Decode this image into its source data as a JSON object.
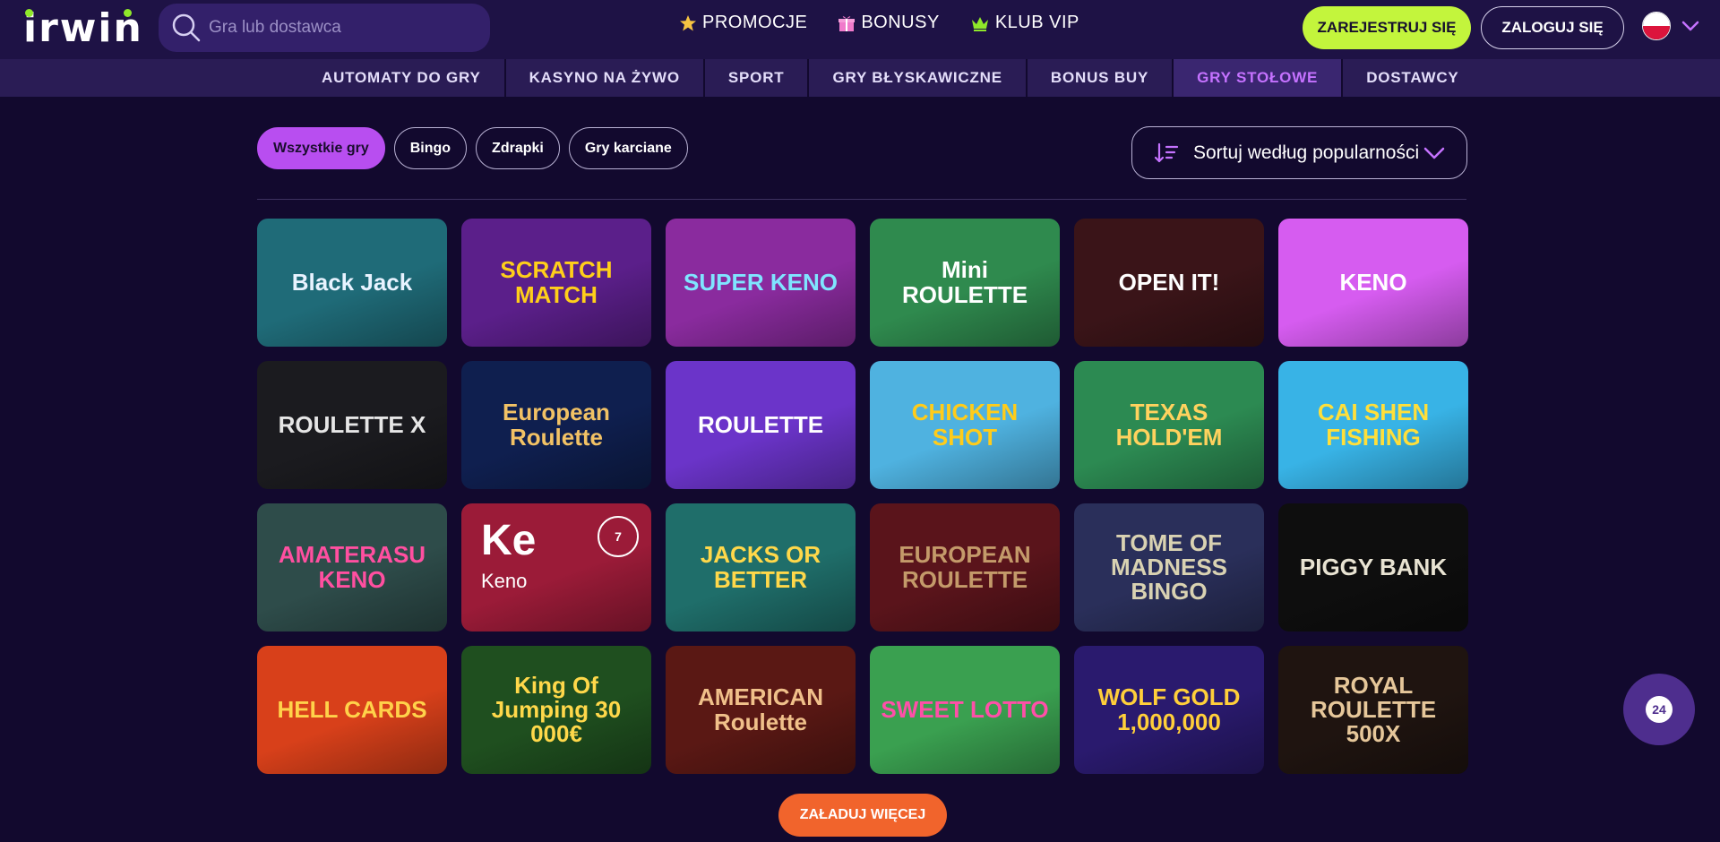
{
  "header": {
    "logo": "irwin",
    "search_placeholder": "Gra lub dostawca",
    "nav": [
      {
        "label": "PROMOCJE",
        "icon": "star-icon"
      },
      {
        "label": "BONUSY",
        "icon": "gift-icon"
      },
      {
        "label": "KLUB VIP",
        "icon": "crown-icon"
      }
    ],
    "register_label": "ZAREJESTRUJ SIĘ",
    "login_label": "ZALOGUJ SIĘ",
    "language_flag": "flag-poland-icon"
  },
  "categories": [
    {
      "label": "AUTOMATY DO GRY",
      "active": false
    },
    {
      "label": "KASYNO NA ŻYWO",
      "active": false
    },
    {
      "label": "SPORT",
      "active": false
    },
    {
      "label": "GRY BŁYSKAWICZNE",
      "active": false
    },
    {
      "label": "BONUS BUY",
      "active": false
    },
    {
      "label": "GRY STOŁOWE",
      "active": true
    },
    {
      "label": "DOSTAWCY",
      "active": false
    }
  ],
  "filters": [
    {
      "label": "Wszystkie gry",
      "active": true
    },
    {
      "label": "Bingo",
      "active": false
    },
    {
      "label": "Zdrapki",
      "active": false
    },
    {
      "label": "Gry karciane",
      "active": false
    }
  ],
  "sort": {
    "label": "Sortuj według popularności"
  },
  "games": [
    {
      "title": "Black Jack",
      "bg": "#1f6b78",
      "color": "#e8f3ff"
    },
    {
      "title": "SCRATCH MATCH",
      "bg": "#5b1f8a",
      "color": "#ffcf1a"
    },
    {
      "title": "SUPER KENO",
      "bg": "#8a2b9e",
      "color": "#7fe5ff"
    },
    {
      "title": "Mini ROULETTE",
      "bg": "#2f8a4e",
      "color": "#ffffff"
    },
    {
      "title": "OPEN IT!",
      "bg": "#3a1418",
      "color": "#ffffff"
    },
    {
      "title": "KENO",
      "bg": "#d65cf0",
      "color": "#ffffff"
    },
    {
      "title": "ROULETTE X",
      "bg": "#1b1b1f",
      "color": "#e6e6e6"
    },
    {
      "title": "European Roulette",
      "bg": "#0f1f4f",
      "color": "#f2c265"
    },
    {
      "title": "ROULETTE",
      "bg": "#6b34c9",
      "color": "#ffffff"
    },
    {
      "title": "CHICKEN SHOT",
      "bg": "#4fb2e0",
      "color": "#ffcc1a"
    },
    {
      "title": "TEXAS HOLD'EM",
      "bg": "#2c8a52",
      "color": "#ffd25e"
    },
    {
      "title": "CAI SHEN FISHING",
      "bg": "#38b3e6",
      "color": "#ffdf3a"
    },
    {
      "title": "AMATERASU KENO",
      "bg": "#2e4c4a",
      "color": "#ff4fa0"
    },
    {
      "title": "Keno",
      "bg": "#9b1b38",
      "color": "#ffffff"
    },
    {
      "title": "JACKS OR BETTER",
      "bg": "#1f6e6a",
      "color": "#ffd84a"
    },
    {
      "title": "EUROPEAN ROULETTE",
      "bg": "#5a141b",
      "color": "#c49a6a"
    },
    {
      "title": "TOME OF MADNESS BINGO",
      "bg": "#2a2f5a",
      "color": "#d9d2b2"
    },
    {
      "title": "PIGGY BANK",
      "bg": "#0e0e0e",
      "color": "#e8e3d2"
    },
    {
      "title": "HELL CARDS",
      "bg": "#d8401a",
      "color": "#ffd24a"
    },
    {
      "title": "King Of Jumping 30 000€",
      "bg": "#1f4f1f",
      "color": "#ffd84a"
    },
    {
      "title": "AMERICAN Roulette",
      "bg": "#5a1814",
      "color": "#f0c08a"
    },
    {
      "title": "SWEET LOTTO",
      "bg": "#3aa050",
      "color": "#ff4fa8"
    },
    {
      "title": "WOLF GOLD 1,000,000",
      "bg": "#2a1a6e",
      "color": "#ffcf3a"
    },
    {
      "title": "ROYAL ROULETTE 500X",
      "bg": "#1f1410",
      "color": "#e6c79a"
    }
  ],
  "load_more_label": "ZAŁADUJ WIĘCEJ",
  "support_badge": "24"
}
